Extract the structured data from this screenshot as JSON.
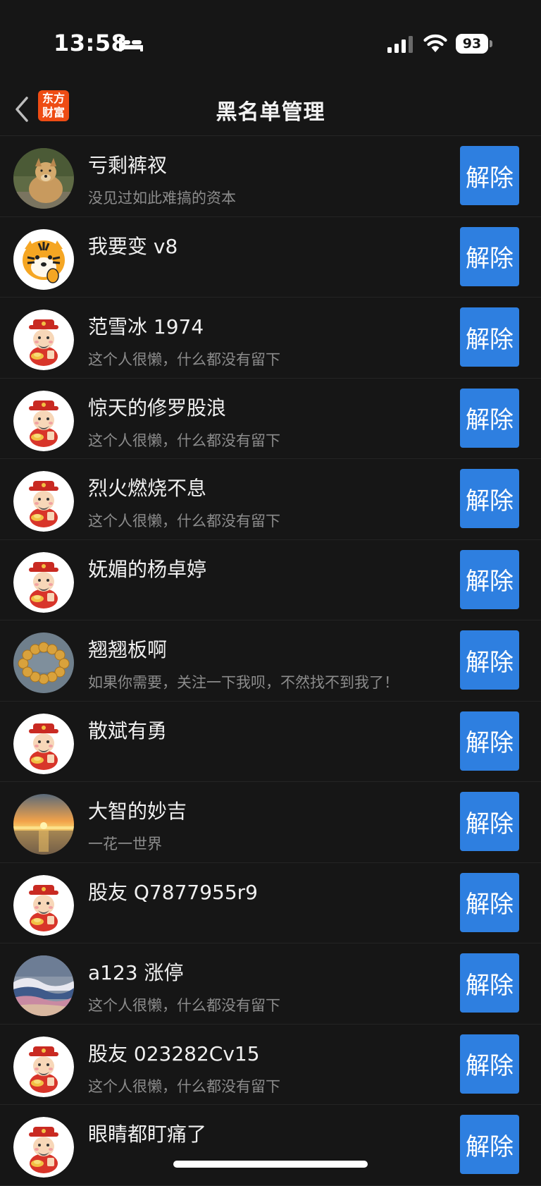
{
  "status_bar": {
    "time": "13:58",
    "battery": "93"
  },
  "nav": {
    "title": "黑名单管理",
    "logo_text": "东方财富",
    "logo_line1": "东方",
    "logo_line2": "财富",
    "back_icon": "chevron-left-icon"
  },
  "colors": {
    "background": "#161616",
    "button": "#2e7fe0",
    "logo": "#ee4c14",
    "bio_text": "#8c8c8c"
  },
  "blocked_users": [
    {
      "name": "亏剩裤衩",
      "bio": "没见过如此难搞的资本",
      "avatar": "dog-photo",
      "action": "解除"
    },
    {
      "name": "我要变 v8",
      "bio": "",
      "avatar": "tiger-cartoon",
      "action": "解除"
    },
    {
      "name": "范雪冰 1974",
      "bio": "这个人很懒，什么都没有留下",
      "avatar": "fortune-god-default",
      "action": "解除"
    },
    {
      "name": "惊天的修罗股浪",
      "bio": "这个人很懒，什么都没有留下",
      "avatar": "fortune-god-default",
      "action": "解除"
    },
    {
      "name": "烈火燃烧不息",
      "bio": "这个人很懒，什么都没有留下",
      "avatar": "fortune-god-default",
      "action": "解除"
    },
    {
      "name": "妩媚的杨卓婷",
      "bio": "",
      "avatar": "fortune-god-default",
      "action": "解除"
    },
    {
      "name": "翘翘板啊",
      "bio": "如果你需要，关注一下我呗，不然找不到我了！",
      "avatar": "beads-photo",
      "action": "解除"
    },
    {
      "name": "散斌有勇",
      "bio": "",
      "avatar": "fortune-god-default",
      "action": "解除"
    },
    {
      "name": "大智的妙吉",
      "bio": "一花一世界",
      "avatar": "sunset-photo",
      "action": "解除"
    },
    {
      "name": "股友 Q7877955r9",
      "bio": "",
      "avatar": "fortune-god-default",
      "action": "解除"
    },
    {
      "name": "a123 涨停",
      "bio": "这个人很懒，什么都没有留下",
      "avatar": "waves-photo",
      "action": "解除"
    },
    {
      "name": "股友 023282Cv15",
      "bio": "这个人很懒，什么都没有留下",
      "avatar": "fortune-god-default",
      "action": "解除"
    },
    {
      "name": "眼睛都盯痛了",
      "bio": "",
      "avatar": "fortune-god-default",
      "action": "解除"
    }
  ]
}
